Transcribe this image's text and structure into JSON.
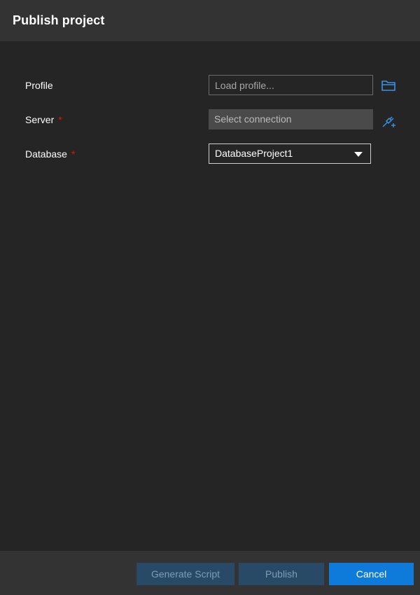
{
  "dialog": {
    "title": "Publish project"
  },
  "form": {
    "profile": {
      "label": "Profile",
      "placeholder": "Load profile...",
      "value": "",
      "browse_icon": "folder-icon"
    },
    "server": {
      "label": "Server",
      "required_marker": "*",
      "placeholder": "Select connection",
      "connect_icon": "plug-add-icon"
    },
    "database": {
      "label": "Database",
      "required_marker": "*",
      "selected": "DatabaseProject1",
      "caret_icon": "caret-down-icon"
    }
  },
  "footer": {
    "generate_script_label": "Generate Script",
    "publish_label": "Publish",
    "cancel_label": "Cancel"
  },
  "colors": {
    "accent": "#0e7ad9",
    "required": "#e51400",
    "disabled_button": "#284a66",
    "icon": "#3794e6"
  }
}
